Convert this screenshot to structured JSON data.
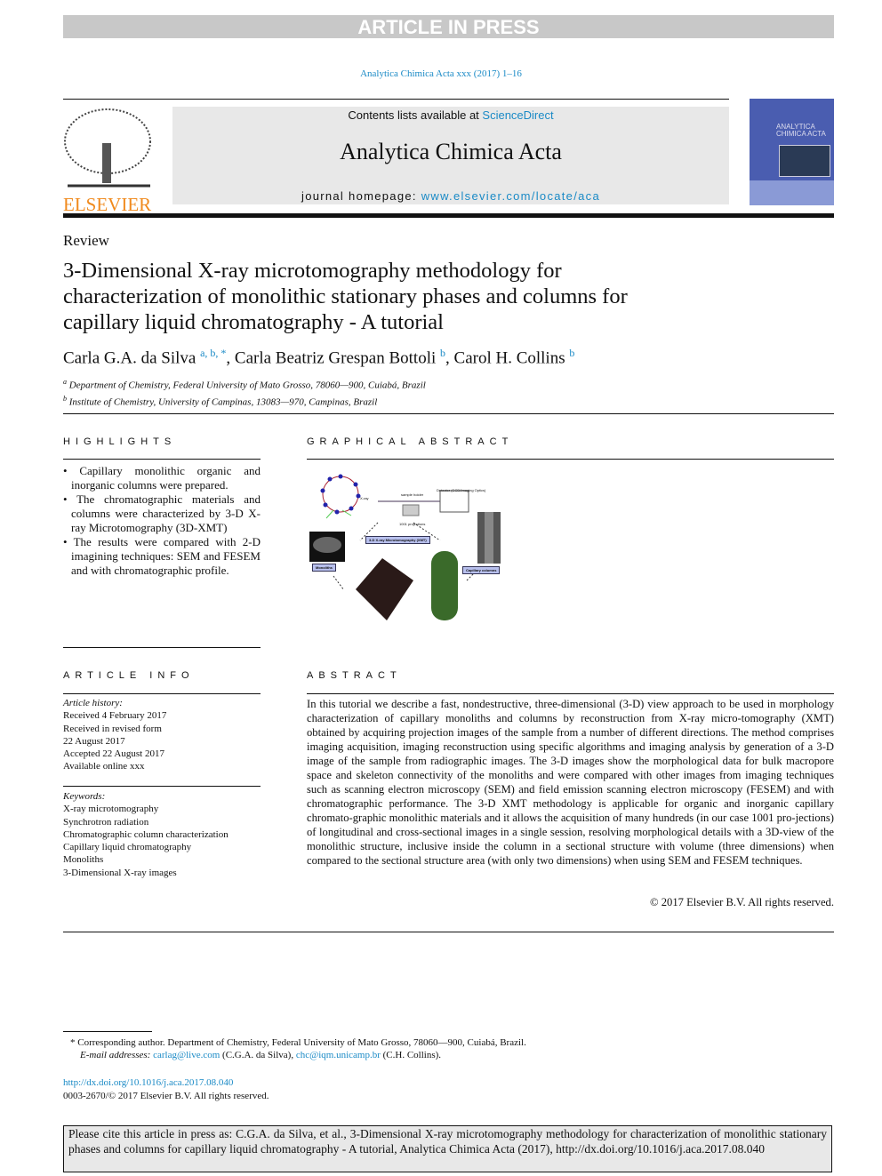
{
  "banner": "ARTICLE IN PRESS",
  "journal_ref": "Analytica Chimica Acta xxx (2017) 1–16",
  "header": {
    "contents_prefix": "Contents lists available at ",
    "contents_link": "ScienceDirect",
    "journal_title": "Analytica Chimica Acta",
    "homepage_prefix": "journal homepage: ",
    "homepage_link": "www.elsevier.com/locate/aca",
    "publisher": "ELSEVIER",
    "cover_title": "ANALYTICA CHIMICA ACTA"
  },
  "article_type": "Review",
  "title": "3-Dimensional X-ray microtomography methodology for characterization of monolithic stationary phases and columns for capillary liquid chromatography - A tutorial",
  "authors": [
    {
      "name": "Carla G.A. da Silva",
      "sup": "a, b, *"
    },
    {
      "name": "Carla Beatriz Grespan Bottoli",
      "sup": "b"
    },
    {
      "name": "Carol H. Collins",
      "sup": "b"
    }
  ],
  "affiliations": [
    {
      "sup": "a",
      "text": "Department of Chemistry, Federal University of Mato Grosso, 78060—900, Cuiabá, Brazil"
    },
    {
      "sup": "b",
      "text": "Institute of Chemistry, University of Campinas, 13083—970, Campinas, Brazil"
    }
  ],
  "highlights": {
    "heading": "HIGHLIGHTS",
    "items": [
      "Capillary monolithic organic and inorganic columns were prepared.",
      "The chromatographic materials and columns were characterized by 3-D X-ray Microtomography (3D-XMT)",
      "The results were compared with 2-D imagining techniques: SEM and FESEM and with chromatographic profile."
    ]
  },
  "graphical_abstract": {
    "heading": "GRAPHICAL ABSTRACT",
    "labels": {
      "center": "3-D X-ray Microtomography (XMT)",
      "left": "Monoliths",
      "right": "Capillary columns",
      "detector": "Detector (CCD/Imaging Optics)",
      "holder": "sample holder",
      "projections": "1001 projections",
      "xray": "X-ray"
    }
  },
  "article_info": {
    "heading": "ARTICLE INFO",
    "history_label": "Article history:",
    "history": [
      "Received 4 February 2017",
      "Received in revised form",
      "22 August 2017",
      "Accepted 22 August 2017",
      "Available online xxx"
    ],
    "keywords_label": "Keywords:",
    "keywords": [
      "X-ray microtomography",
      "Synchrotron radiation",
      "Chromatographic column characterization",
      "Capillary liquid chromatography",
      "Monoliths",
      "3-Dimensional X-ray images"
    ]
  },
  "abstract": {
    "heading": "ABSTRACT",
    "text": "In this tutorial we describe a fast, nondestructive, three-dimensional (3-D) view approach to be used in morphology characterization of capillary monoliths and columns by reconstruction from X-ray micro-tomography (XMT) obtained by acquiring projection images of the sample from a number of different directions. The method comprises imaging acquisition, imaging reconstruction using specific algorithms and imaging analysis by generation of a 3-D image of the sample from radiographic images. The 3-D images show the morphological data for bulk macropore space and skeleton connectivity of the monoliths and were compared with other images from imaging techniques such as scanning electron microscopy (SEM) and field emission scanning electron microscopy (FESEM) and with chromatographic performance. The 3-D XMT methodology is applicable for organic and inorganic capillary chromato-graphic monolithic materials and it allows the acquisition of many hundreds (in our case 1001 pro-jections) of longitudinal and cross-sectional images in a single session, resolving morphological details with a 3D-view of the monolithic structure, inclusive inside the column in a sectional structure with volume (three dimensions) when compared to the sectional structure area (with only two dimensions) when using SEM and FESEM techniques.",
    "copyright": "© 2017 Elsevier B.V. All rights reserved."
  },
  "footnote": {
    "corresponding": "* Corresponding author. Department of Chemistry, Federal University of Mato Grosso, 78060—900, Cuiabá, Brazil.",
    "email_label": "E-mail addresses: ",
    "email1": "carlag@live.com",
    "email1_who": " (C.G.A. da Silva), ",
    "email2": "chc@iqm.unicamp.br",
    "email2_who": " (C.H. Collins)."
  },
  "doi": "http://dx.doi.org/10.1016/j.aca.2017.08.040",
  "issn": "0003-2670/© 2017 Elsevier B.V. All rights reserved.",
  "cite": "Please cite this article in press as: C.G.A. da Silva, et al., 3-Dimensional X-ray microtomography methodology for characterization of monolithic stationary phases and columns for capillary liquid chromatography - A tutorial, Analytica Chimica Acta (2017), http://dx.doi.org/10.1016/j.aca.2017.08.040",
  "colors": {
    "link": "#1a8ac6",
    "elsevier": "#f08a1d",
    "cover": "#4a5db0"
  }
}
